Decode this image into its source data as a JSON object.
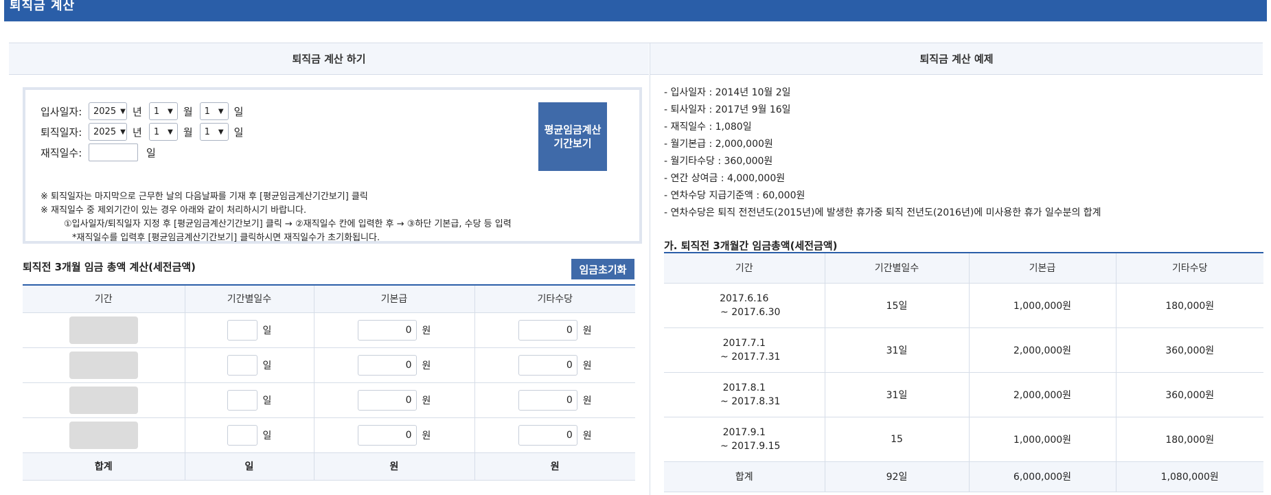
{
  "header": {
    "title": "퇴직금 계산"
  },
  "left": {
    "section_title": "퇴직금 계산 하기",
    "form": {
      "join_label": "입사일자:",
      "leave_label": "퇴직일자:",
      "service_label": "재직일수:",
      "year_value": "2025",
      "month_value": "1",
      "day_value": "1",
      "unit_year": "년",
      "unit_month": "월",
      "unit_day": "일",
      "service_unit": "일"
    },
    "period_button": "평균임금계산 기간보기",
    "notes": [
      "※ 퇴직일자는 마지막으로 근무한 날의 다음날짜를 기재 후 [평균임금계산기간보기] 클릭",
      "※ 재직일수 중 제외기간이 있는 경우 아래와 같이 처리하시기 바랍니다.",
      "①입사일자/퇴직일자 지정 후 [평균임금계산기간보기] 클릭 → ②재직일수 칸에 입력한 후 → ③하단 기본급, 수당 등 입력",
      "*재직일수를 입력후 [평균임금계산기간보기] 클릭하시면 재직일수가 초기화됩니다."
    ],
    "sub_title": "퇴직전 3개월 임금 총액 계산(세전금액)",
    "reset_button": "임금초기화",
    "table": {
      "headers": [
        "기간",
        "기간별일수",
        "기본급",
        "기타수당"
      ],
      "rows": [
        {
          "days_unit": "일",
          "base": "0",
          "base_unit": "원",
          "other": "0",
          "other_unit": "원"
        },
        {
          "days_unit": "일",
          "base": "0",
          "base_unit": "원",
          "other": "0",
          "other_unit": "원"
        },
        {
          "days_unit": "일",
          "base": "0",
          "base_unit": "원",
          "other": "0",
          "other_unit": "원"
        },
        {
          "days_unit": "일",
          "base": "0",
          "base_unit": "원",
          "other": "0",
          "other_unit": "원"
        }
      ],
      "total": {
        "label": "합계",
        "days": "일",
        "base": "원",
        "other": "원"
      }
    }
  },
  "right": {
    "section_title": "퇴직금 계산 예제",
    "facts": [
      "- 입사일자 : 2014년 10월 2일",
      "- 퇴사일자 : 2017년 9월 16일",
      "- 재직일수 : 1,080일",
      "- 월기본급 : 2,000,000원",
      "- 월기타수당 : 360,000원",
      "- 연간 상여금 : 4,000,000원",
      "- 연차수당 지급기준액 : 60,000원",
      "- 연차수당은 퇴직 전전년도(2015년)에 발생한 휴가중 퇴직 전년도(2016년)에 미사용한 휴가 일수분의 합계"
    ],
    "sub_title": "가. 퇴직전 3개월간 임금총액(세전금액)",
    "table": {
      "headers": [
        "기간",
        "기간별일수",
        "기본급",
        "기타수당"
      ],
      "rows": [
        {
          "from": "2017.6.16",
          "to": "~ 2017.6.30",
          "days": "15일",
          "base": "1,000,000원",
          "other": "180,000원"
        },
        {
          "from": "2017.7.1",
          "to": "~ 2017.7.31",
          "days": "31일",
          "base": "2,000,000원",
          "other": "360,000원"
        },
        {
          "from": "2017.8.1",
          "to": "~ 2017.8.31",
          "days": "31일",
          "base": "2,000,000원",
          "other": "360,000원"
        },
        {
          "from": "2017.9.1",
          "to": "~ 2017.9.15",
          "days": "15",
          "base": "1,000,000원",
          "other": "180,000원"
        }
      ],
      "total": {
        "label": "합계",
        "days": "92일",
        "base": "6,000,000원",
        "other": "1,080,000원"
      }
    }
  },
  "colors": {
    "header_blue": "#2a5ea8",
    "button_blue": "#3f6aa9",
    "head_bg": "#f3f6fb"
  },
  "icons": {
    "select": "chevron-down-icon"
  }
}
